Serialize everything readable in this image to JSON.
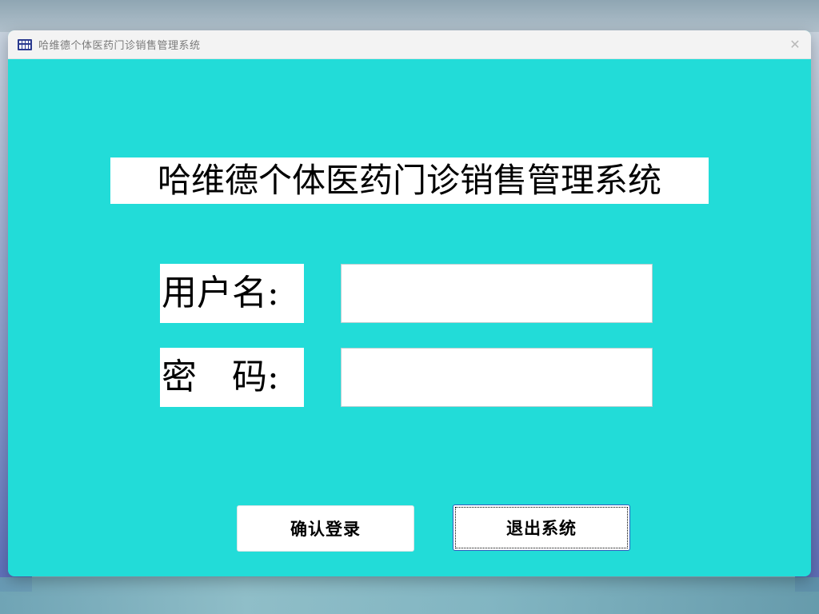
{
  "window": {
    "title": "哈维德个体医药门诊销售管理系统",
    "icon": "grid-app-icon",
    "close_icon": "✕"
  },
  "login": {
    "heading": "哈维德个体医药门诊销售管理系统",
    "username_label": "用户名:",
    "password_label": "密　码:",
    "username_value": "",
    "password_value": ""
  },
  "buttons": {
    "confirm_label": "确认登录",
    "exit_label": "退出系统"
  },
  "colors": {
    "window_background": "#22dcd8",
    "titlebar": "#f3f3f3"
  }
}
